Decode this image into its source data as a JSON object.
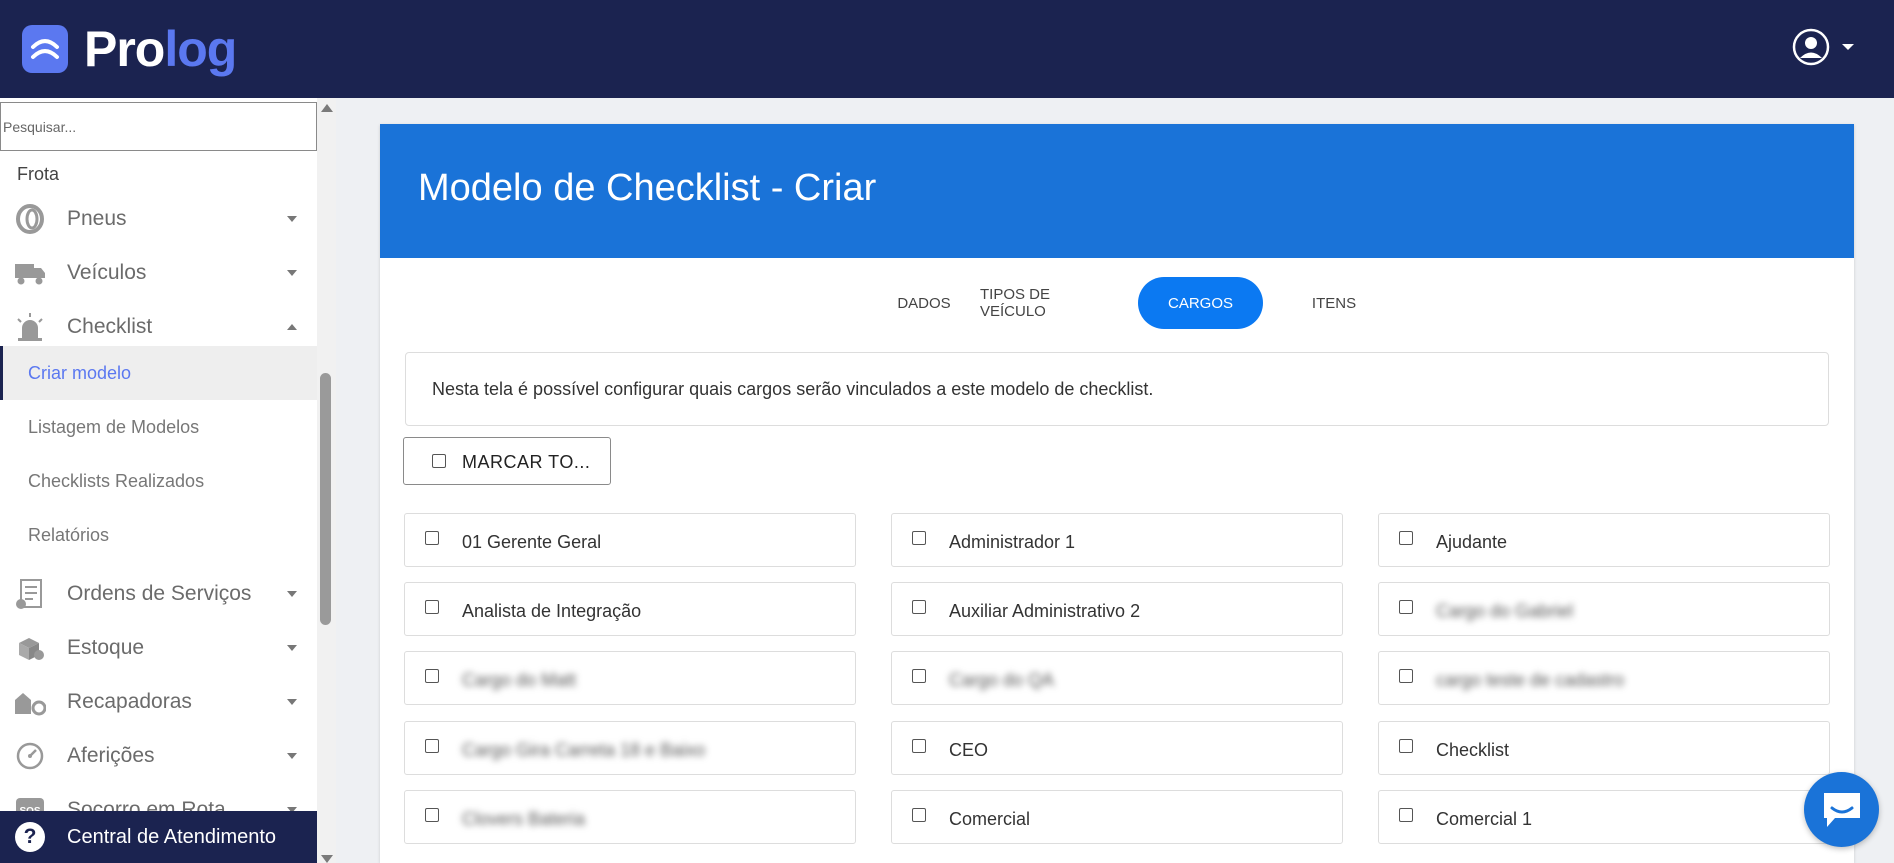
{
  "header": {
    "logo_pro": "Pro",
    "logo_log": "log"
  },
  "sidebar": {
    "search_placeholder": "Pesquisar...",
    "section": "Frota",
    "items": [
      {
        "label": "Pneus",
        "icon": "tire-icon"
      },
      {
        "label": "Veículos",
        "icon": "truck-icon"
      },
      {
        "label": "Checklist",
        "icon": "siren-icon"
      },
      {
        "label": "Ordens de Serviços",
        "icon": "service-order-icon"
      },
      {
        "label": "Estoque",
        "icon": "boxes-icon"
      },
      {
        "label": "Recapadoras",
        "icon": "factory-icon"
      },
      {
        "label": "Aferições",
        "icon": "gauge-icon"
      },
      {
        "label": "Socorro em Rota",
        "icon": "sos-icon"
      }
    ],
    "checklist_sub": [
      "Criar modelo",
      "Listagem de Modelos",
      "Checklists Realizados",
      "Relatórios"
    ],
    "help": "Central de Atendimento"
  },
  "main": {
    "title": "Modelo de Checklist - Criar",
    "tabs": [
      "DADOS",
      "TIPOS DE VEÍCULO",
      "CARGOS",
      "ITENS"
    ],
    "active_tab": "CARGOS",
    "info": "Nesta tela é possível configurar quais cargos serão vinculados a este modelo de checklist.",
    "mark_all": "MARCAR TO...",
    "roles": [
      "01 Gerente Geral",
      "Administrador 1",
      "Ajudante",
      "Analista de Integração",
      "Auxiliar Administrativo 2",
      "Cargo do Gabriel",
      "Cargo do Matt",
      "Cargo do QA",
      "cargo teste de cadastro",
      "Cargo Gira Carreta 18 e Baixo",
      "CEO",
      "Checklist",
      "Clovers Bateria",
      "Comercial",
      "Comercial 1"
    ]
  },
  "colors": {
    "header_bg": "#1b2350",
    "brand_accent": "#5b78f0",
    "card_header": "#1a73d8",
    "active_tab": "#0b79f2"
  }
}
